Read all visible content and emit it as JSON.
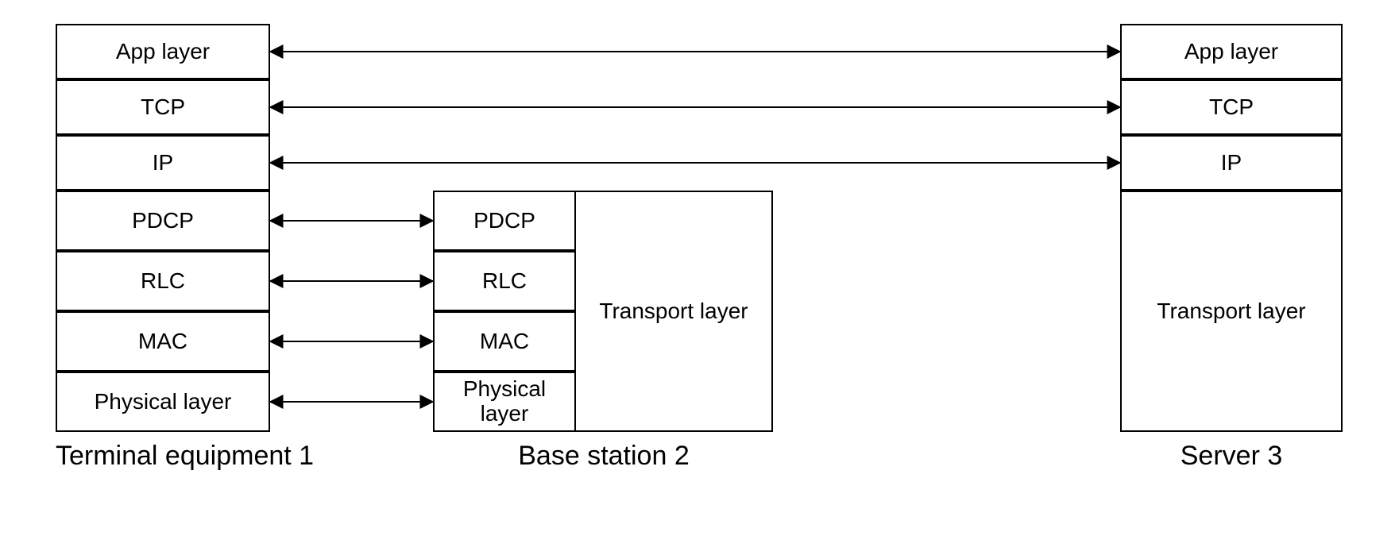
{
  "terminal": {
    "caption": "Terminal equipment 1",
    "layers": {
      "app": "App layer",
      "tcp": "TCP",
      "ip": "IP",
      "pdcp": "PDCP",
      "rlc": "RLC",
      "mac": "MAC",
      "phy": "Physical layer"
    }
  },
  "base_station": {
    "caption": "Base station 2",
    "layers": {
      "pdcp": "PDCP",
      "rlc": "RLC",
      "mac": "MAC",
      "phy": "Physical layer",
      "transport": "Transport layer"
    }
  },
  "server": {
    "caption": "Server 3",
    "layers": {
      "app": "App layer",
      "tcp": "TCP",
      "ip": "IP",
      "transport": "Transport layer"
    }
  }
}
